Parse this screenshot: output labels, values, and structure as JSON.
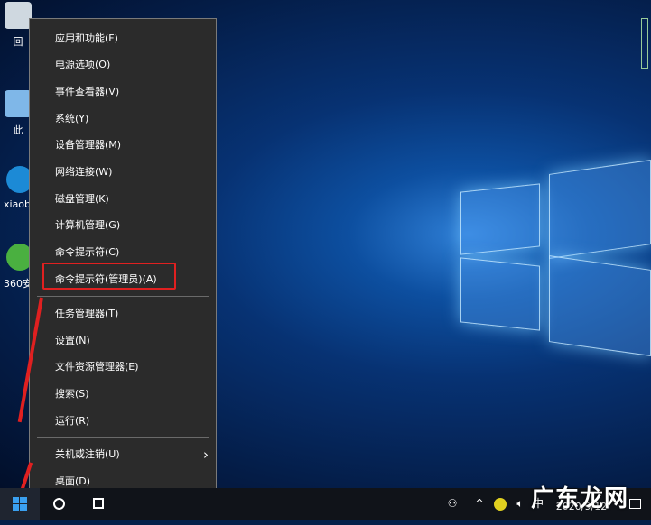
{
  "desktop": {
    "icons": [
      {
        "label": "回"
      },
      {
        "label": "此"
      },
      {
        "label": "xiaob"
      },
      {
        "label": "360安"
      }
    ]
  },
  "menu": {
    "group1": [
      "应用和功能(F)",
      "电源选项(O)",
      "事件查看器(V)",
      "系统(Y)",
      "设备管理器(M)",
      "网络连接(W)",
      "磁盘管理(K)",
      "计算机管理(G)",
      "命令提示符(C)",
      "命令提示符(管理员)(A)"
    ],
    "group2": [
      "任务管理器(T)",
      "设置(N)",
      "文件资源管理器(E)",
      "搜索(S)",
      "运行(R)"
    ],
    "group3": [
      "关机或注销(U)",
      "桌面(D)"
    ],
    "submenu_arrow": "›",
    "highlight_color": "#e02020"
  },
  "taskbar": {
    "ime": "中",
    "date": "2020/9/12",
    "tray_up": "^"
  },
  "watermark": "广东龙网"
}
